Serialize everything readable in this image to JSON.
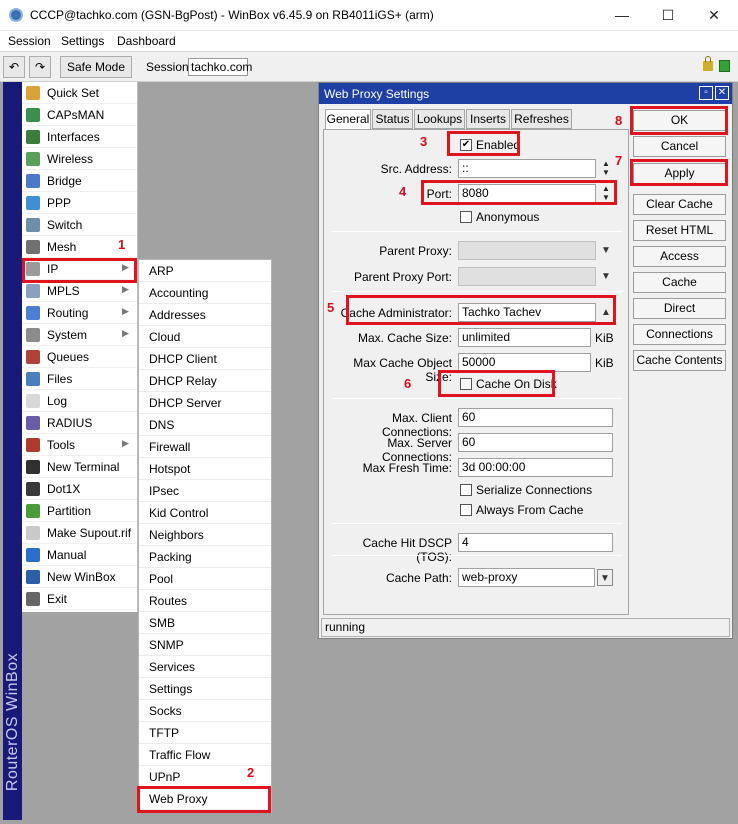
{
  "window": {
    "title": "CCCP@tachko.com (GSN-BgPost) - WinBox v6.45.9 on RB4011iGS+ (arm)",
    "min_glyph": "—",
    "max_glyph": "☐",
    "close_glyph": "✕"
  },
  "menubar": [
    "Session",
    "Settings",
    "Dashboard"
  ],
  "toolbar": {
    "undo_icon": "undo-icon",
    "undo_glyph": "↶",
    "redo_icon": "redo-icon",
    "redo_glyph": "↷",
    "safe_mode": "Safe Mode",
    "session_label": "Session:",
    "session_value": "tachko.com"
  },
  "brand": "RouterOS WinBox",
  "main_menu": [
    {
      "label": "Quick Set",
      "icon": "quickset-icon",
      "color": "#d9a23a",
      "arrow": false
    },
    {
      "label": "CAPsMAN",
      "icon": "capsman-icon",
      "color": "#3a8f4a",
      "arrow": false
    },
    {
      "label": "Interfaces",
      "icon": "interfaces-icon",
      "color": "#3a7d3a",
      "arrow": false
    },
    {
      "label": "Wireless",
      "icon": "wireless-icon",
      "color": "#5aa05a",
      "arrow": false
    },
    {
      "label": "Bridge",
      "icon": "bridge-icon",
      "color": "#4a79c9",
      "arrow": false
    },
    {
      "label": "PPP",
      "icon": "ppp-icon",
      "color": "#3f8fd6",
      "arrow": false
    },
    {
      "label": "Switch",
      "icon": "switch-icon",
      "color": "#6b8fa8",
      "arrow": false
    },
    {
      "label": "Mesh",
      "icon": "mesh-icon",
      "color": "#707070",
      "arrow": false
    },
    {
      "label": "IP",
      "icon": "ip-icon",
      "color": "#9a9a9a",
      "arrow": true
    },
    {
      "label": "MPLS",
      "icon": "mpls-icon",
      "color": "#8aa0c0",
      "arrow": true
    },
    {
      "label": "Routing",
      "icon": "routing-icon",
      "color": "#4b7fd1",
      "arrow": true
    },
    {
      "label": "System",
      "icon": "system-icon",
      "color": "#8c8c8c",
      "arrow": true
    },
    {
      "label": "Queues",
      "icon": "queues-icon",
      "color": "#b0423a",
      "arrow": false
    },
    {
      "label": "Files",
      "icon": "files-icon",
      "color": "#4a7fbf",
      "arrow": false
    },
    {
      "label": "Log",
      "icon": "log-icon",
      "color": "#d8d8d8",
      "arrow": false
    },
    {
      "label": "RADIUS",
      "icon": "radius-icon",
      "color": "#6b5ca8",
      "arrow": false
    },
    {
      "label": "Tools",
      "icon": "tools-icon",
      "color": "#b03a2e",
      "arrow": true
    },
    {
      "label": "New Terminal",
      "icon": "terminal-icon",
      "color": "#303030",
      "arrow": false
    },
    {
      "label": "Dot1X",
      "icon": "dot1x-icon",
      "color": "#3a3a3a",
      "arrow": false
    },
    {
      "label": "Partition",
      "icon": "partition-icon",
      "color": "#4a9b3a",
      "arrow": false
    },
    {
      "label": "Make Supout.rif",
      "icon": "supout-icon",
      "color": "#c9c9c9",
      "arrow": false
    },
    {
      "label": "Manual",
      "icon": "manual-icon",
      "color": "#2a6fc9",
      "arrow": false
    },
    {
      "label": "New WinBox",
      "icon": "winbox-icon",
      "color": "#2b5fa8",
      "arrow": false
    },
    {
      "label": "Exit",
      "icon": "exit-icon",
      "color": "#666666",
      "arrow": false
    }
  ],
  "ip_submenu": [
    "ARP",
    "Accounting",
    "Addresses",
    "Cloud",
    "DHCP Client",
    "DHCP Relay",
    "DHCP Server",
    "DNS",
    "Firewall",
    "Hotspot",
    "IPsec",
    "Kid Control",
    "Neighbors",
    "Packing",
    "Pool",
    "Routes",
    "SMB",
    "SNMP",
    "Services",
    "Settings",
    "Socks",
    "TFTP",
    "Traffic Flow",
    "UPnP",
    "Web Proxy"
  ],
  "dialog": {
    "title": "Web Proxy Settings",
    "tabs": [
      "General",
      "Status",
      "Lookups",
      "Inserts",
      "Refreshes"
    ],
    "enabled": {
      "label": "Enabled",
      "checked": true
    },
    "src_address": {
      "label": "Src. Address:",
      "value": "::"
    },
    "port": {
      "label": "Port:",
      "value": "8080"
    },
    "anonymous": {
      "label": "Anonymous",
      "checked": false
    },
    "parent_proxy": {
      "label": "Parent Proxy:",
      "value": ""
    },
    "parent_proxy_port": {
      "label": "Parent Proxy Port:",
      "value": ""
    },
    "cache_admin": {
      "label": "Cache Administrator:",
      "value": "Tachko Tachev"
    },
    "max_cache_size": {
      "label": "Max. Cache Size:",
      "value": "unlimited",
      "unit": "KiB"
    },
    "max_cache_object_size": {
      "label": "Max Cache Object Size:",
      "value": "50000",
      "unit": "KiB"
    },
    "cache_on_disk": {
      "label": "Cache On Disk",
      "checked": false
    },
    "max_client_conn": {
      "label": "Max. Client Connections:",
      "value": "60"
    },
    "max_server_conn": {
      "label": "Max. Server Connections:",
      "value": "60"
    },
    "max_fresh_time": {
      "label": "Max Fresh Time:",
      "value": "3d 00:00:00"
    },
    "serialize_conn": {
      "label": "Serialize Connections",
      "checked": false
    },
    "always_from_cache": {
      "label": "Always From Cache",
      "checked": false
    },
    "cache_hit_dscp": {
      "label": "Cache Hit DSCP (TOS):",
      "value": "4"
    },
    "cache_path": {
      "label": "Cache Path:",
      "value": "web-proxy"
    },
    "status": "running",
    "buttons": [
      "OK",
      "Cancel",
      "Apply",
      "Clear Cache",
      "Reset HTML",
      "Access",
      "Cache",
      "Direct",
      "Connections",
      "Cache Contents"
    ]
  },
  "annotations": [
    "1",
    "2",
    "3",
    "4",
    "5",
    "6",
    "7",
    "8"
  ],
  "annotation_color": "#e0141e"
}
